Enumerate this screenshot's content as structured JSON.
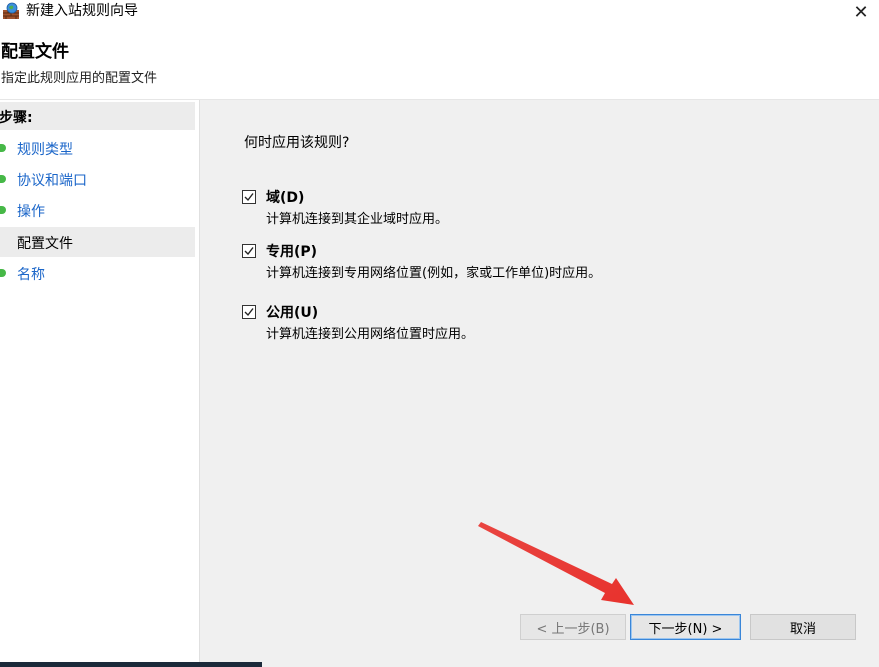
{
  "window": {
    "title": "新建入站规则向导",
    "close_glyph": "✕"
  },
  "header": {
    "title": "配置文件",
    "subtitle": "指定此规则应用的配置文件"
  },
  "sidebar": {
    "heading": "步骤:",
    "steps": [
      {
        "label": "规则类型",
        "active": false
      },
      {
        "label": "协议和端口",
        "active": false
      },
      {
        "label": "操作",
        "active": false
      },
      {
        "label": "配置文件",
        "active": true
      },
      {
        "label": "名称",
        "active": false
      }
    ]
  },
  "main": {
    "question": "何时应用该规则?",
    "options": [
      {
        "title": "域(D)",
        "description": "计算机连接到其企业域时应用。",
        "checked": true
      },
      {
        "title": "专用(P)",
        "description": "计算机连接到专用网络位置(例如，家或工作单位)时应用。",
        "checked": true
      },
      {
        "title": "公用(U)",
        "description": "计算机连接到公用网络位置时应用。",
        "checked": true
      }
    ]
  },
  "buttons": {
    "back": "< 上一步(B)",
    "next": "下一步(N) >",
    "cancel": "取消"
  },
  "colors": {
    "accent": "#1b66c9",
    "step_dot": "#46b847",
    "arrow": "#e8322d",
    "focus_border": "#3a86d8"
  }
}
